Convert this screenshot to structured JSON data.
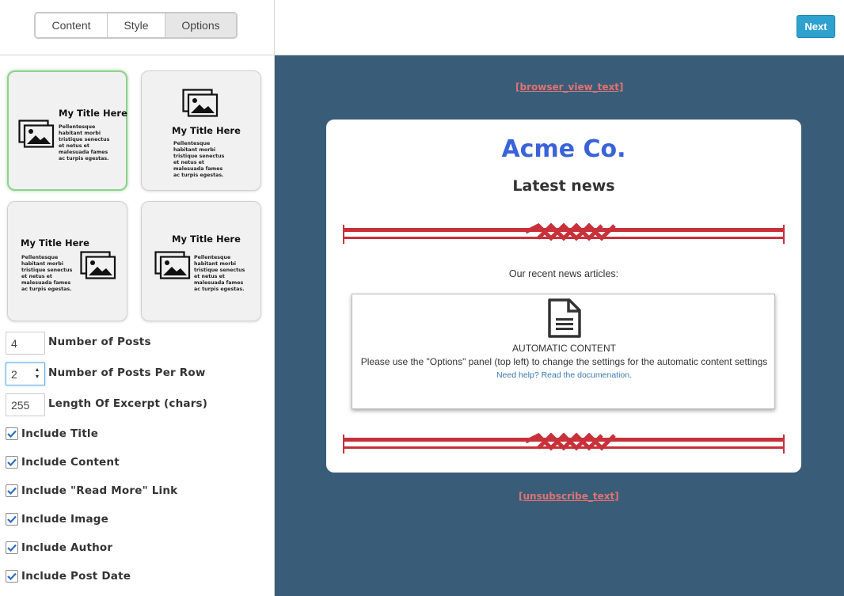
{
  "tabs": [
    {
      "label": "Content",
      "active": false
    },
    {
      "label": "Style",
      "active": false
    },
    {
      "label": "Options",
      "active": true
    }
  ],
  "layouts": [
    {
      "title": "My Title Here",
      "body": "Pellentesque habitant morbi tristique senectus et netus et malesuada fames ac turpis egestas.",
      "selected": true
    },
    {
      "title": "My Title Here",
      "body": "Pellentesque habitant morbi tristique senectus et netus et malesuada fames ac turpis egestas.",
      "selected": false
    },
    {
      "title": "My Title Here",
      "body": "Pellentesque habitant morbi tristique senectus et netus et malesuada fames ac turpis egestas.",
      "selected": false
    },
    {
      "title": "My Title Here",
      "body": "Pellentesque habitant morbi tristique senectus et netus et malesuada fames ac turpis egestas.",
      "selected": false
    }
  ],
  "options": {
    "num_posts": {
      "label": "Number of Posts",
      "value": "4"
    },
    "posts_per_row": {
      "label": "Number of Posts Per Row",
      "value": "2"
    },
    "excerpt_length": {
      "label": "Length Of Excerpt (chars)",
      "value": "255"
    }
  },
  "checkboxes": [
    {
      "label": "Include Title",
      "checked": true
    },
    {
      "label": "Include Content",
      "checked": true
    },
    {
      "label": "Include \"Read More\" Link",
      "checked": true
    },
    {
      "label": "Include Image",
      "checked": true
    },
    {
      "label": "Include Author",
      "checked": true
    },
    {
      "label": "Include Post Date",
      "checked": true
    }
  ],
  "toolbar": {
    "next_label": "Next"
  },
  "preview": {
    "browser_view_text": "[browser_view_text]",
    "company": "Acme Co.",
    "headline": "Latest news",
    "intro": "Our recent news articles:",
    "auto_title": "AUTOMATIC CONTENT",
    "auto_desc": "Please use the \"Options\" panel (top left) to change the settings for the automatic content settings",
    "auto_help": "Need help? Read the documenation.",
    "unsubscribe_text": "[unsubscribe_text]"
  },
  "colors": {
    "preview_bg": "#395d78",
    "company_blue": "#3a62d9",
    "link_red": "#e27272",
    "next_button": "#2ea1cf",
    "divider_red": "#c8313a"
  }
}
